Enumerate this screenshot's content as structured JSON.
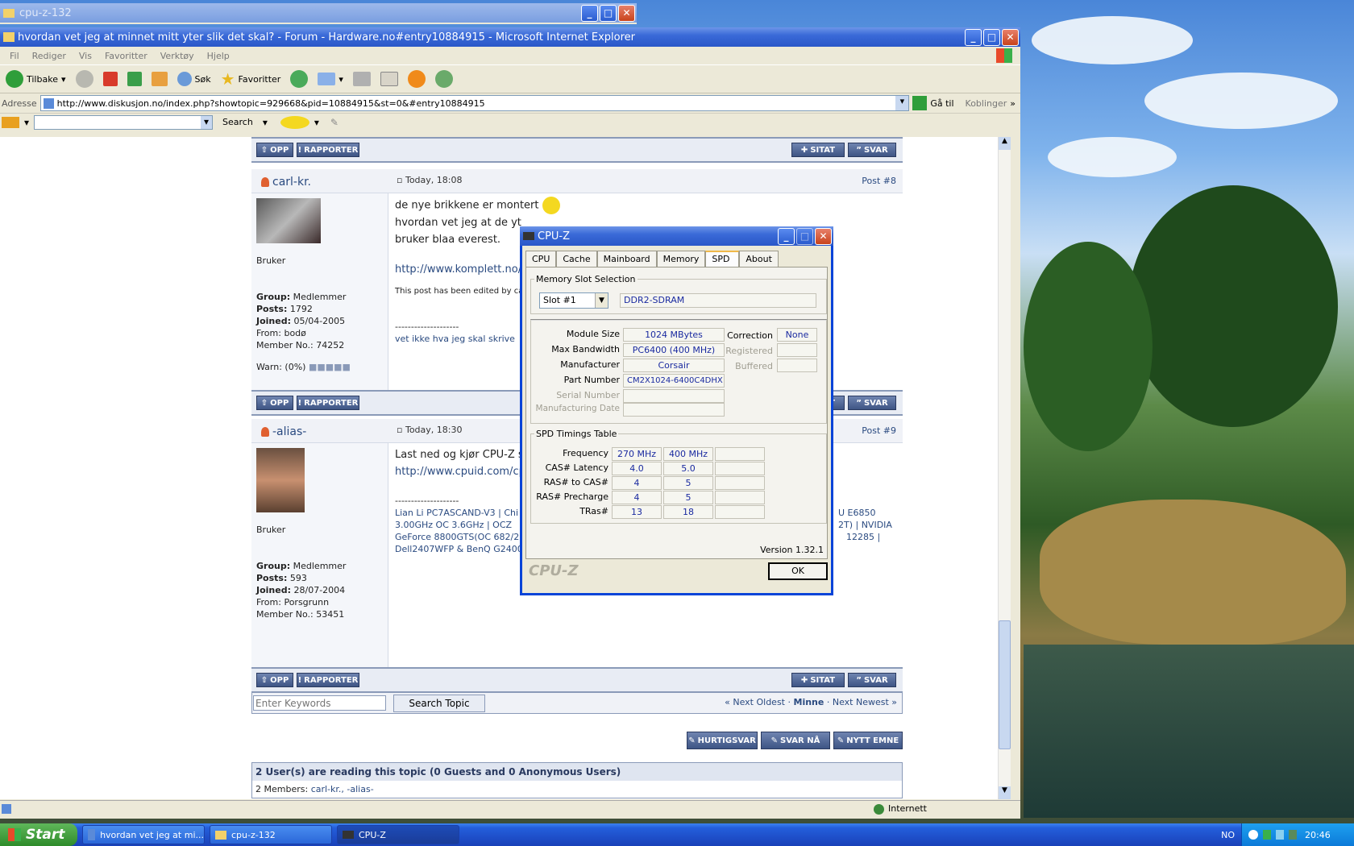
{
  "bg_window": {
    "title": "cpu-z-132"
  },
  "ie": {
    "title": "hvordan vet jeg at minnet mitt yter slik det skal? - Forum - Hardware.no#entry10884915 - Microsoft Internet Explorer",
    "menu": [
      "Fil",
      "Rediger",
      "Vis",
      "Favoritter",
      "Verktøy",
      "Hjelp"
    ],
    "toolbar": {
      "back": "Tilbake",
      "search": "Søk",
      "favorites": "Favoritter"
    },
    "address_label": "Adresse",
    "address": "http://www.diskusjon.no/index.php?showtopic=929668&pid=10884915&st=0&#entry10884915",
    "go": "Gå til",
    "links": "Koblinger",
    "search_btn": "Search",
    "status": "Internett"
  },
  "forum": {
    "opp": "OPP",
    "rapporter": "RAPPORTER",
    "sitat": "SITAT",
    "svar": "SVAR",
    "posts": [
      {
        "user": "carl-kr.",
        "time": "Today, 18:08",
        "num": "Post #8",
        "rank": "Bruker",
        "group_label": "Group:",
        "group": "Medlemmer",
        "posts_label": "Posts:",
        "posts": "1792",
        "joined_label": "Joined:",
        "joined": "05/04-2005",
        "from": "From: bodø",
        "member": "Member No.: 74252",
        "warn": "Warn: (0%)",
        "line1": "de nye brikkene er montert",
        "line2": "hvordan vet jeg at de yt",
        "line3": "bruker blaa everest.",
        "link": "http://www.komplett.no/",
        "edited": "This post has been edited by ca",
        "sig_sep": "--------------------",
        "sig": "vet ikke hva jeg skal skrive"
      },
      {
        "user": "-alias-",
        "time": "Today, 18:30",
        "num": "Post #9",
        "rank": "Bruker",
        "group_label": "Group:",
        "group": "Medlemmer",
        "posts_label": "Posts:",
        "posts": "593",
        "joined_label": "Joined:",
        "joined": "28/07-2004",
        "from": "From: Porsgrunn",
        "member": "Member No.: 53451",
        "line1": "Last ned og kjør CPU-Z s",
        "link": "http://www.cpuid.com/cp",
        "sig_sep": "--------------------",
        "sig1": "Lian Li PC7ASCAND-V3 | Chi",
        "sig1b": "U E6850",
        "sig2": "3.00GHz OC 3.6GHz | OCZ",
        "sig2b": "2T) | NVIDIA",
        "sig3": "GeForce 8800GTS(OC 682/2",
        "sig3b": "12285 |",
        "sig4": "Dell2407WFP & BenQ G2400"
      }
    ],
    "keywords_placeholder": "Enter Keywords",
    "search_topic": "Search Topic",
    "nav_prev": "« Next Oldest",
    "nav_sep1": "·",
    "nav_mine": "Minne",
    "nav_sep2": "·",
    "nav_next": "Next Newest »",
    "hurtigsvar": "HURTIGSVAR",
    "svar_na": "SVAR NÅ",
    "nytt_emne": "NYTT EMNE",
    "readers": "2 User(s) are reading this topic (0 Guests and 0 Anonymous Users)",
    "members_label": "2 Members:",
    "members": "carl-kr., -alias-"
  },
  "cpuz": {
    "title": "CPU-Z",
    "tabs": [
      "CPU",
      "Cache",
      "Mainboard",
      "Memory",
      "SPD",
      "About"
    ],
    "active_tab": "SPD",
    "slot_legend": "Memory Slot Selection",
    "slot": "Slot #1",
    "mem_type": "DDR2-SDRAM",
    "module_size_label": "Module Size",
    "module_size": "1024 MBytes",
    "max_bw_label": "Max Bandwidth",
    "max_bw": "PC6400 (400 MHz)",
    "manufacturer_label": "Manufacturer",
    "manufacturer": "Corsair",
    "part_label": "Part Number",
    "part": "CM2X1024-6400C4DHX",
    "serial_label": "Serial Number",
    "mfg_date_label": "Manufacturing Date",
    "correction_label": "Correction",
    "correction": "None",
    "registered_label": "Registered",
    "buffered_label": "Buffered",
    "timings_legend": "SPD Timings Table",
    "timings": [
      {
        "label": "Frequency",
        "a": "270 MHz",
        "b": "400 MHz"
      },
      {
        "label": "CAS# Latency",
        "a": "4.0",
        "b": "5.0"
      },
      {
        "label": "RAS# to CAS#",
        "a": "4",
        "b": "5"
      },
      {
        "label": "RAS# Precharge",
        "a": "4",
        "b": "5"
      },
      {
        "label": "TRas#",
        "a": "13",
        "b": "18"
      }
    ],
    "version": "Version 1.32.1",
    "brand": "CPU-Z",
    "ok": "OK"
  },
  "taskbar": {
    "start": "Start",
    "tasks": [
      "hvordan vet jeg at mi...",
      "cpu-z-132",
      "CPU-Z"
    ],
    "lang": "NO",
    "clock": "20:46"
  }
}
